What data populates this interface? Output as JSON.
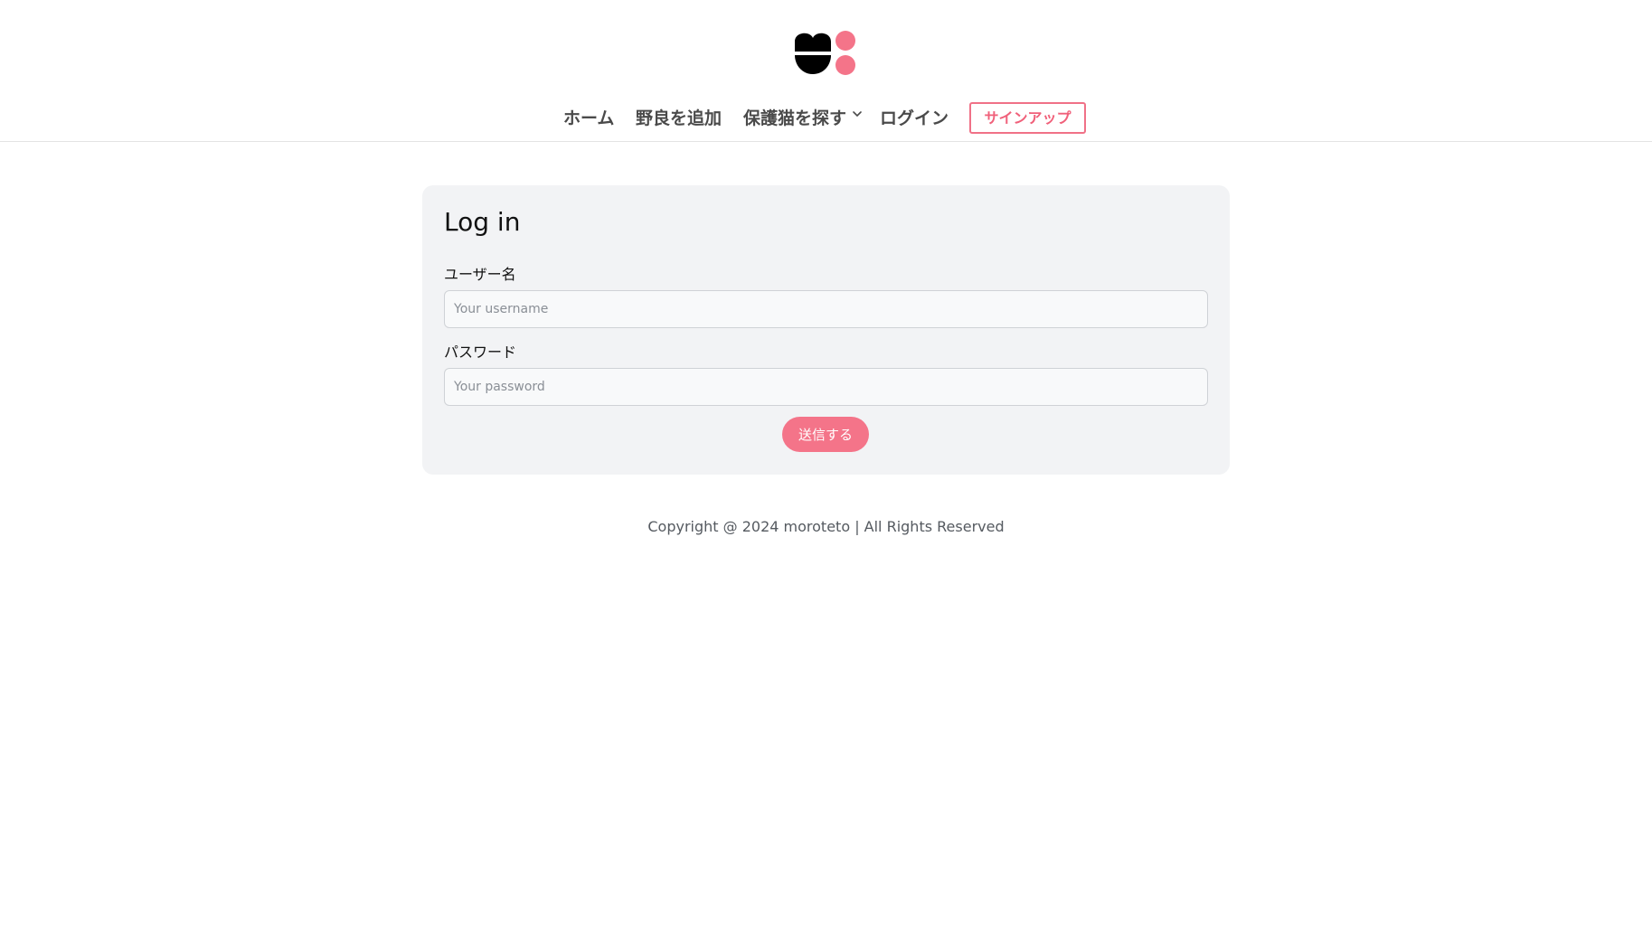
{
  "header": {
    "logo_icon": "cat-paws-logo-icon",
    "nav": {
      "home": "ホーム",
      "add_stray": "野良を追加",
      "find_cats": "保護猫を探す",
      "login": "ログイン",
      "signup": "サインアップ"
    },
    "dropdown_icon": "chevron-down-icon"
  },
  "login_form": {
    "title": "Log in",
    "username_label": "ユーザー名",
    "username_placeholder": "Your username",
    "username_value": "",
    "password_label": "パスワード",
    "password_placeholder": "Your password",
    "password_value": "",
    "submit_label": "送信する"
  },
  "footer": {
    "copyright": "Copyright @ 2024 moroteto | All Rights Reserved"
  },
  "colors": {
    "accent": "#f47489",
    "signup_border": "#f07187",
    "card_background": "#f2f3f5",
    "nav_text": "#4a4a4a"
  }
}
